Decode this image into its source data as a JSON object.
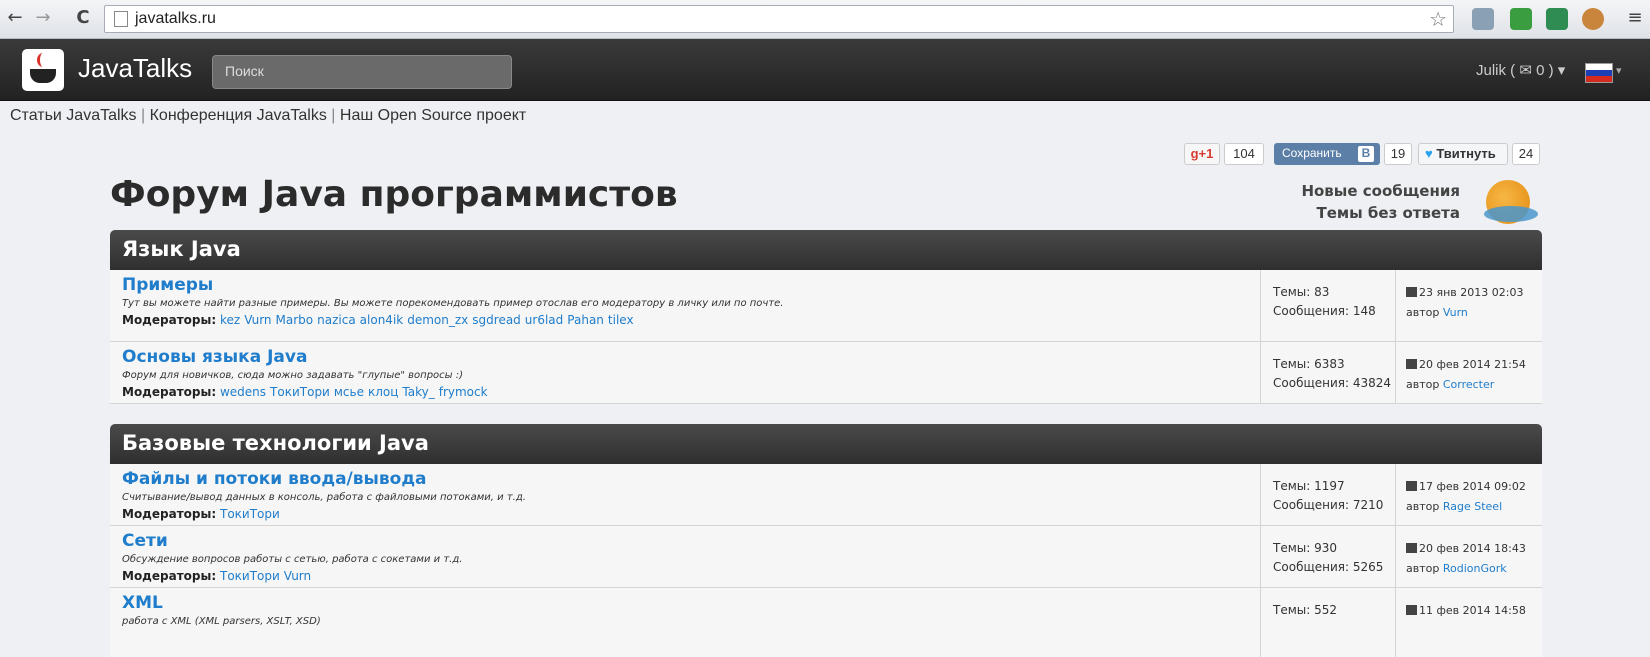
{
  "browser": {
    "url": "javatalks.ru",
    "back_icon": "←",
    "forward_icon": "→",
    "reload_icon": "C",
    "star_icon": "☆"
  },
  "site": {
    "brand": "JavaTalks",
    "search_placeholder": "Поиск",
    "user": "Julik ( ✉ 0 ) ▾",
    "links": [
      "Статьи JavaTalks",
      "Конференция JavaTalks",
      "Наш Open Source проект"
    ],
    "links_separator": "|"
  },
  "social": {
    "gplus_label": "g+1",
    "gplus_count": "104",
    "vk_label": "Сохранить",
    "vk_letter": "В",
    "vk_count": "19",
    "twitter_label": "Твитнуть",
    "twitter_count": "24"
  },
  "page": {
    "title": "Форум Java программистов",
    "new_posts": "Новые сообщения",
    "unanswered": "Темы без ответа"
  },
  "moderators_label": "Модераторы:",
  "categories": [
    {
      "title": "Язык Java"
    },
    {
      "title": "Базовые технологии Java"
    }
  ],
  "forums": [
    {
      "name": "Примеры",
      "description": "Тут вы можете найти разные примеры. Вы можете порекомендовать пример отослав его модератору в личку или по почте.",
      "moderators": [
        "kez",
        "Vurn",
        "Marbo",
        "nazica",
        "alon4ik",
        "demon_zx",
        "sgdread",
        "ur6lad",
        "Pahan",
        "tilex"
      ],
      "topics": "Темы: 83",
      "posts": "Сообщения: 148",
      "last_date": "23 янв 2013 02:03",
      "last_prefix": "автор",
      "last_author": "Vurn"
    },
    {
      "name": "Основы языка Java",
      "description": "Форум для новичков, сюда можно задавать \"глупые\" вопросы :)",
      "moderators": [
        "wedens",
        "ТокиТори",
        "мсье",
        "клоц",
        "Taky_",
        "frymock"
      ],
      "topics": "Темы: 6383",
      "posts": "Сообщения: 43824",
      "last_date": "20 фев 2014 21:54",
      "last_prefix": "автор",
      "last_author": "Correcter"
    },
    {
      "name": "Файлы и потоки ввода/вывода",
      "description": "Считывание/вывод данных в консоль, работа с файловыми потоками, и т.д.",
      "moderators": [
        "ТокиТори"
      ],
      "topics": "Темы: 1197",
      "posts": "Сообщения: 7210",
      "last_date": "17 фев 2014 09:02",
      "last_prefix": "автор",
      "last_author": "Rage Steel"
    },
    {
      "name": "Сети",
      "description": "Обсуждение вопросов работы с сетью, работа с сокетами и т.д.",
      "moderators": [
        "ТокиТори",
        "Vurn"
      ],
      "topics": "Темы: 930",
      "posts": "Сообщения: 5265",
      "last_date": "20 фев 2014 18:43",
      "last_prefix": "автор",
      "last_author": "RodionGork"
    },
    {
      "name": "XML",
      "description": "работа с XML (XML parsers, XSLT, XSD)",
      "moderators": [],
      "topics": "Темы: 552",
      "posts": "",
      "last_date": "11 фев 2014 14:58",
      "last_prefix": "",
      "last_author": ""
    }
  ]
}
